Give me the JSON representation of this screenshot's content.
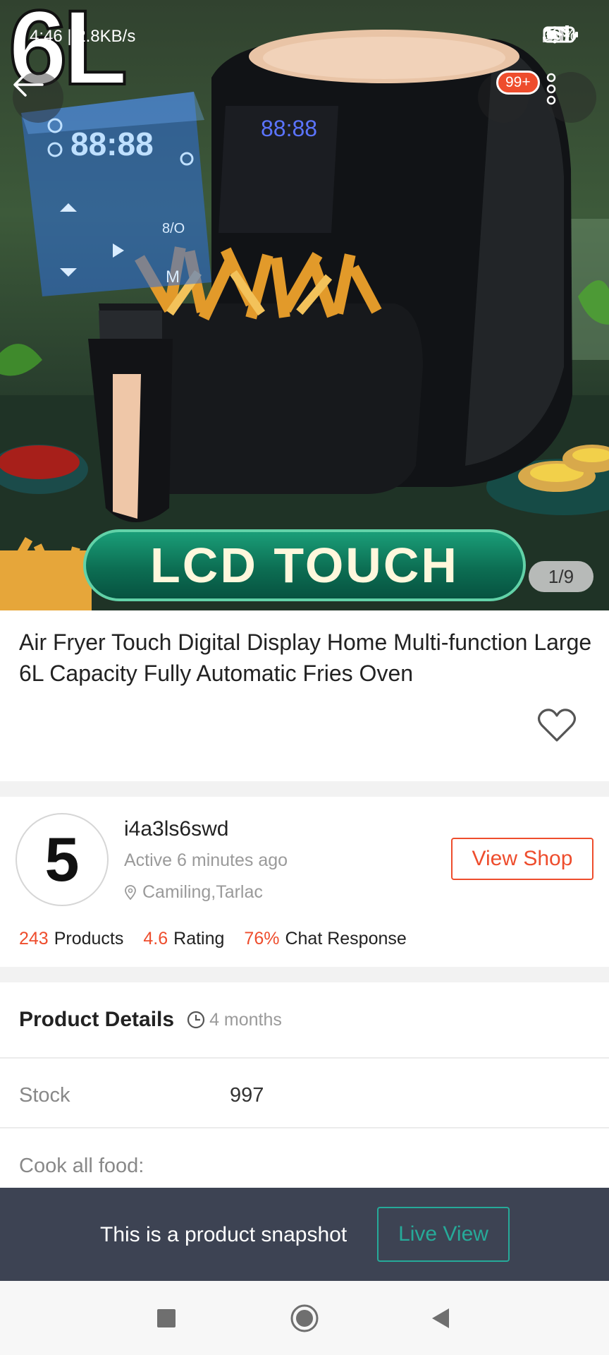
{
  "status_bar": {
    "time": "4:46 | 2.8KB/s",
    "battery": "33%"
  },
  "hero": {
    "watermark": "6L",
    "cart_badge": "99+",
    "banner_text": "LCD TOUCH",
    "page_indicator": "1/9",
    "display_readout": "88:88",
    "device_readout": "88:88"
  },
  "product": {
    "title": "Air Fryer Touch Digital Display Home Multi-function Large 6L Capacity Fully Automatic Fries Oven"
  },
  "shop": {
    "avatar_text": "5",
    "name": "i4a3ls6swd",
    "active": "Active 6 minutes ago",
    "location": "Camiling,Tarlac",
    "view_shop_label": "View Shop",
    "stats": [
      {
        "value": "243",
        "label": "Products"
      },
      {
        "value": "4.6",
        "label": "Rating"
      },
      {
        "value": "76%",
        "label": "Chat Response"
      }
    ]
  },
  "details": {
    "title": "Product Details",
    "age": "4 months",
    "stock_label": "Stock",
    "stock_value": "997",
    "cook_label": "Cook all food:"
  },
  "snapshot": {
    "text": "This is a product snapshot",
    "live_view_label": "Live View"
  },
  "colors": {
    "accent": "#ee4d2d",
    "teal": "#26aa99",
    "snapshot_bg": "#3d4353"
  }
}
